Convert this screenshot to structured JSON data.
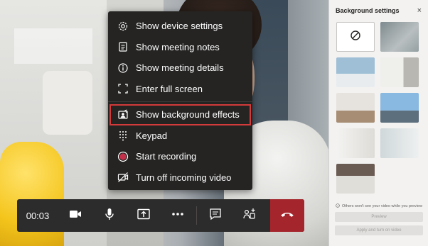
{
  "call": {
    "timer": "00:03"
  },
  "menu": {
    "items": [
      {
        "label": "Show device settings",
        "icon": "gear-icon"
      },
      {
        "label": "Show meeting notes",
        "icon": "notes-icon"
      },
      {
        "label": "Show meeting details",
        "icon": "info-icon"
      },
      {
        "label": "Enter full screen",
        "icon": "fullscreen-icon"
      },
      {
        "label": "Show background effects",
        "icon": "background-effects-icon",
        "highlighted": true
      },
      {
        "label": "Keypad",
        "icon": "keypad-icon"
      },
      {
        "label": "Start recording",
        "icon": "record-icon"
      },
      {
        "label": "Turn off incoming video",
        "icon": "video-off-icon"
      }
    ]
  },
  "toolbar": {
    "buttons": [
      "camera-icon",
      "microphone-icon",
      "share-screen-icon",
      "more-options-icon",
      "chat-icon",
      "participants-icon",
      "hang-up-icon"
    ]
  },
  "background_panel": {
    "title": "Background settings",
    "close_glyph": "×",
    "note": "Others won't see your video while you preview",
    "preview_label": "Preview",
    "apply_label": "Apply and turn on video"
  },
  "colors": {
    "highlight_outline": "#d33a3a",
    "hangup": "#a4262c",
    "menu_bg": "#252423"
  }
}
